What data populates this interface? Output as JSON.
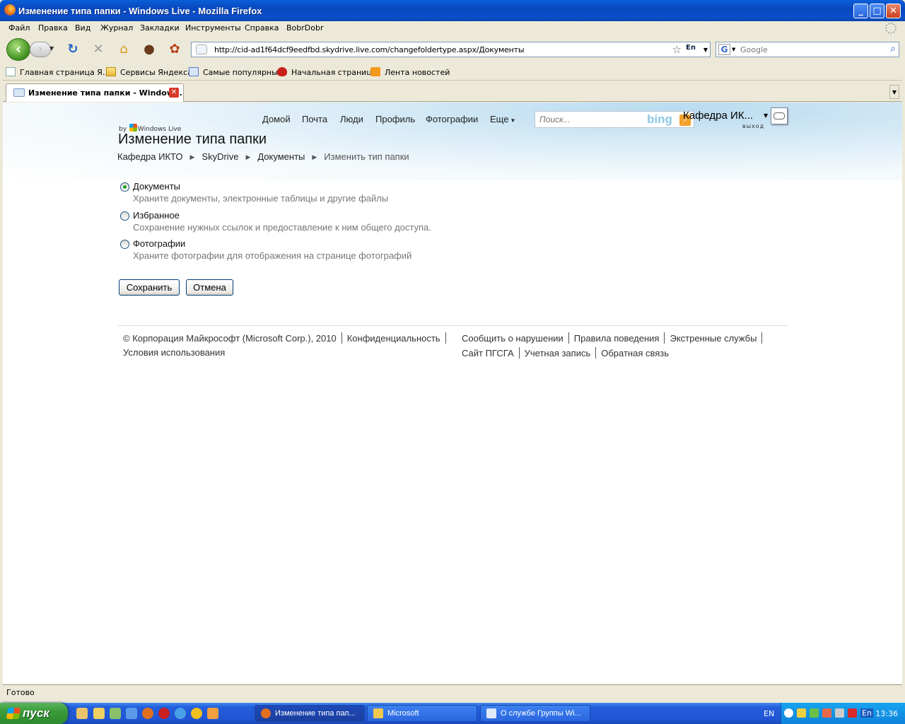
{
  "window": {
    "title": "Изменение типа папки - Windows Live - Mozilla Firefox"
  },
  "menu": [
    "Файл",
    "Правка",
    "Вид",
    "Журнал",
    "Закладки",
    "Инструменты",
    "Справка",
    "BobrDobr"
  ],
  "navbar": {
    "url": "http://cid-ad1f64dcf9eedfbd.skydrive.live.com/changefoldertype.aspx/Документы",
    "lang_badge": "En",
    "search_placeholder": "Google"
  },
  "bookmarks": [
    {
      "label": "Главная страница Я...",
      "icon": "page-icon"
    },
    {
      "label": "Сервисы Яндекса",
      "icon": "folder-icon"
    },
    {
      "label": "Самые популярные",
      "icon": "magnifier-icon"
    },
    {
      "label": "Начальная страница",
      "icon": "redhat-icon"
    },
    {
      "label": "Лента новостей",
      "icon": "rss-icon"
    }
  ],
  "tab": {
    "label": "Изменение типа папки - Window..."
  },
  "page": {
    "nav": [
      "Домой",
      "Почта",
      "Люди",
      "Профиль",
      "Фотографии",
      "Еще"
    ],
    "search_placeholder": "Поиск...",
    "bing": "bing",
    "user_name": "Кафедра ИК...",
    "signout": "выход",
    "by_prefix": "by",
    "by_brand": "Windows Live",
    "title": "Изменение типа папки",
    "breadcrumb": [
      "Кафедра ИКТО",
      "SkyDrive",
      "Документы",
      "Изменить тип папки"
    ],
    "options": [
      {
        "label": "Документы",
        "desc": "Храните документы, электронные таблицы и другие файлы",
        "checked": true
      },
      {
        "label": "Избранное",
        "desc": "Сохранение нужных ссылок и предоставление к ним общего доступа.",
        "checked": false
      },
      {
        "label": "Фотографии",
        "desc": "Храните фотографии для отображения на странице фотографий",
        "checked": false
      }
    ],
    "save_label": "Сохранить",
    "cancel_label": "Отмена",
    "footer": {
      "copyright": "© Корпорация Майкрософт (Microsoft Corp.), 2010",
      "privacy": "Конфиденциальность",
      "terms": "Условия использования",
      "report": "Сообщить о нарушении",
      "conduct": "Правила поведения",
      "emergency": "Экстренные службы",
      "site": "Сайт ПГСГА",
      "account": "Учетная запись",
      "feedback": "Обратная связь"
    }
  },
  "status": "Готово",
  "taskbar": {
    "start": "пуск",
    "tasks": [
      "Изменение типа пап...",
      "Microsoft",
      "О службе Группы Wi..."
    ],
    "lang": "EN",
    "tray_lang": "En",
    "clock": "13:36"
  }
}
